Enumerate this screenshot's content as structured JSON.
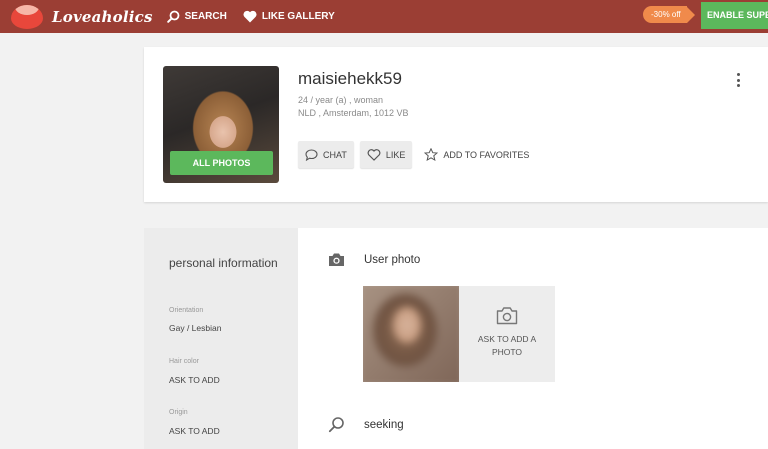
{
  "topbar": {
    "brand": "Loveaholics",
    "nav": [
      {
        "label": "SEARCH",
        "icon": "search-icon"
      },
      {
        "label": "LIKE GALLERY",
        "icon": "heart-icon"
      }
    ],
    "promo_badge": "-30% off",
    "enable_button": "ENABLE SUPER",
    "colors": {
      "bar": "#9b3e34",
      "accent": "#5cb85c",
      "promo": "#f08a4b"
    }
  },
  "profile": {
    "username": "maisiehekk59",
    "age_gender": "24 / year (a) , woman",
    "location": "NLD , Amsterdam, 1012 VB",
    "all_photos_button": "ALL PHOTOS",
    "actions": {
      "chat": "CHAT",
      "like": "LIKE",
      "favorites": "ADD TO FAVORITES"
    }
  },
  "personal_info": {
    "title": "personal information",
    "fields": [
      {
        "label": "Orientation",
        "value": "Gay / Lesbian"
      },
      {
        "label": "Hair color",
        "value": "ASK TO ADD"
      },
      {
        "label": "Origin",
        "value": "ASK TO ADD"
      }
    ]
  },
  "main": {
    "user_photo_heading": "User photo",
    "ask_photo_label": "ASK TO ADD A PHOTO",
    "seeking_heading": "seeking"
  }
}
